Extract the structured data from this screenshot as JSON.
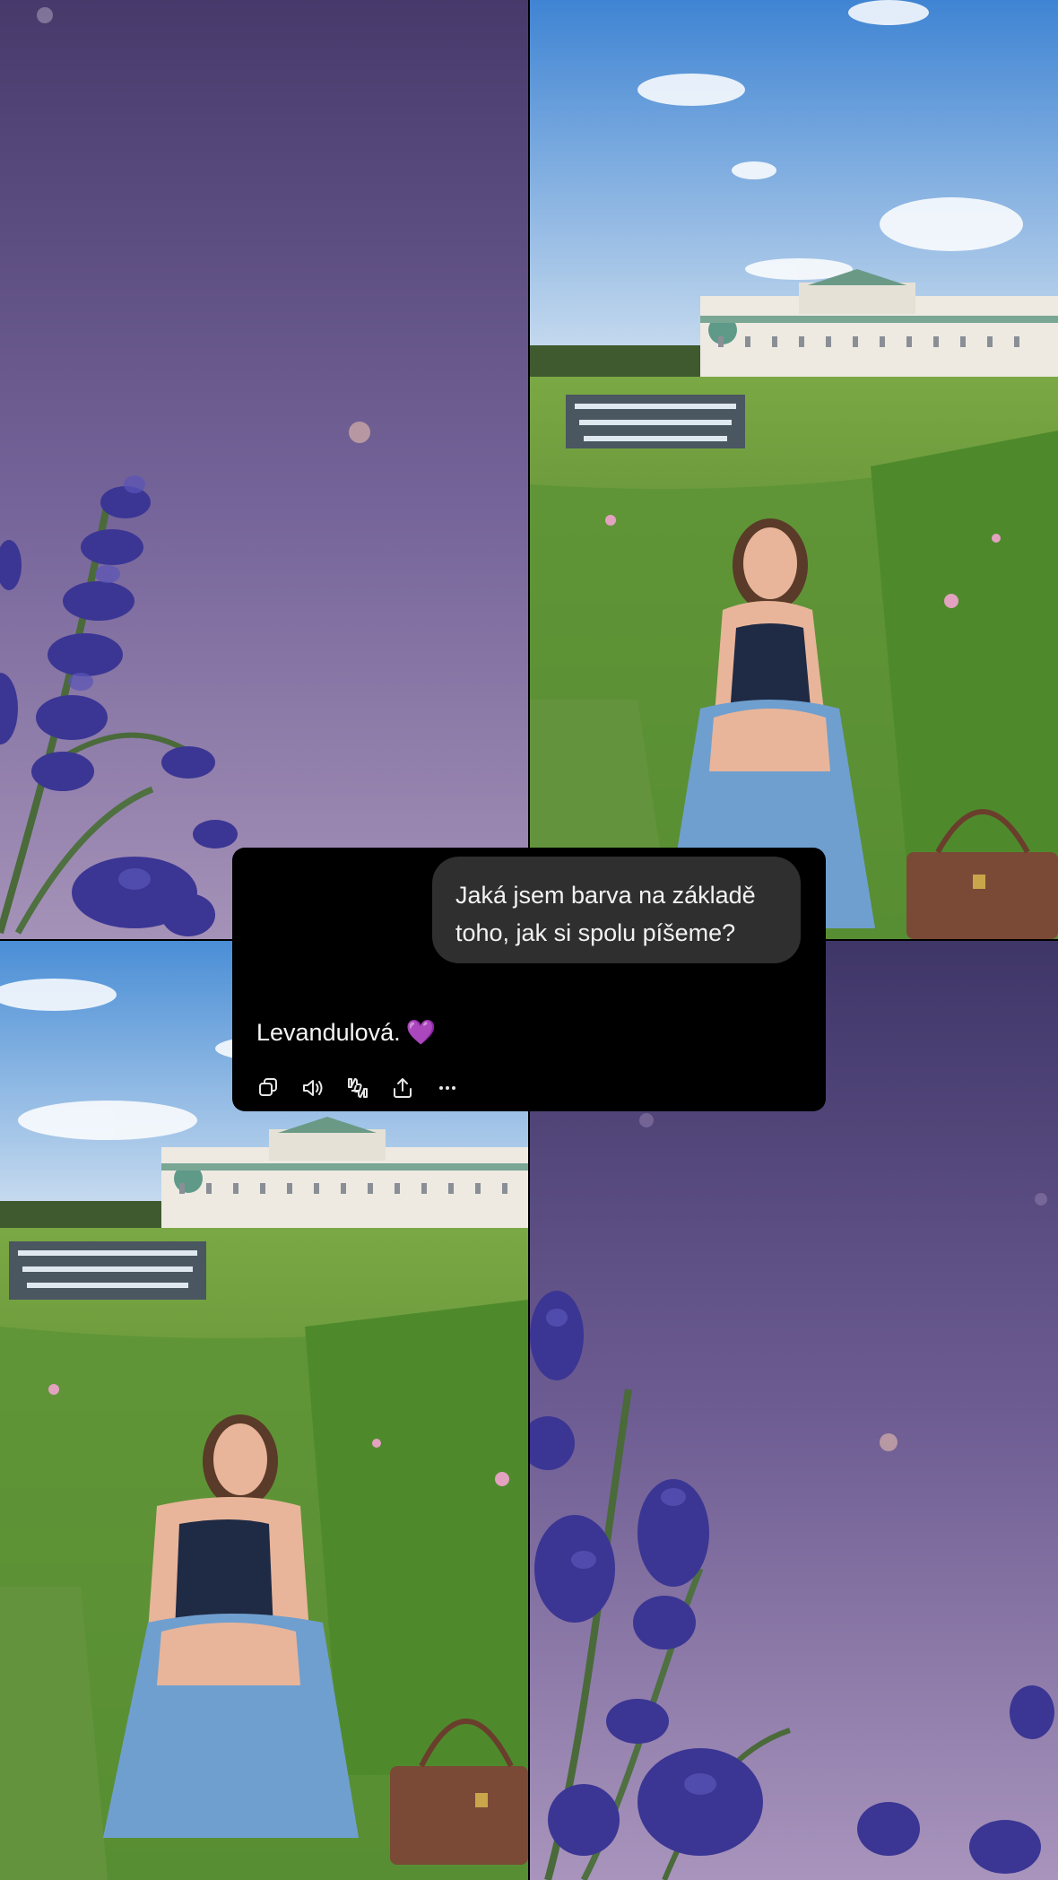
{
  "chat": {
    "user_message": {
      "line1": "Jaká jsem barva na základě",
      "line2": "toho, jak si spolu píšeme?"
    },
    "assistant_message": {
      "text": "Levandulová.",
      "emoji": "💜"
    },
    "actions": [
      {
        "icon": "copy-icon",
        "label": "Copy"
      },
      {
        "icon": "speaker-icon",
        "label": "Read aloud"
      },
      {
        "icon": "thumbs-feedback-icon",
        "label": "Feedback"
      },
      {
        "icon": "share-icon",
        "label": "Share"
      },
      {
        "icon": "more-icon",
        "label": "More"
      }
    ]
  },
  "colors": {
    "lavender_sky_top": "#4a3d6e",
    "lavender_sky_bottom": "#9a86b2",
    "lavender_flower": "#3f3a9a",
    "sky_blue": "#4f8fd6",
    "grass": "#6c9b3a",
    "skirt_blue": "#6f9fcf",
    "bubble_bg": "#2f2f2f",
    "card_bg": "#000000"
  }
}
